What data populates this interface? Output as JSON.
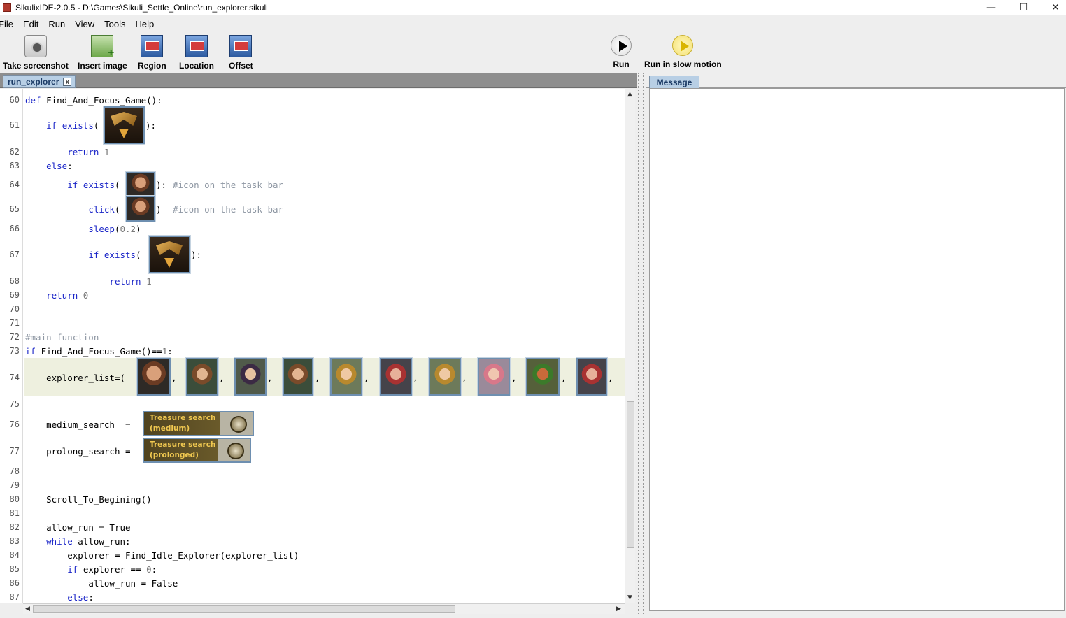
{
  "window": {
    "title": "SikulixIDE-2.0.5 - D:\\Games\\Sikuli_Settle_Online\\run_explorer.sikuli",
    "minimize": "—",
    "maximize": "☐",
    "close": "✕"
  },
  "menu": [
    "File",
    "Edit",
    "Run",
    "View",
    "Tools",
    "Help"
  ],
  "toolbar": {
    "take_screenshot": "Take screenshot",
    "insert_image": "Insert image",
    "region": "Region",
    "location": "Location",
    "offset": "Offset",
    "run": "Run",
    "run_slow": "Run in slow motion"
  },
  "tabs": {
    "editor_tab": "run_explorer",
    "close_symbol": "x",
    "message_tab": "Message"
  },
  "editor": {
    "lines": [
      {
        "n": "60",
        "text": "def Find_And_Focus_Game():"
      },
      {
        "n": "61",
        "text": "    if exists("
      },
      {
        "n": "62",
        "text": "        return 1"
      },
      {
        "n": "63",
        "text": "    else:"
      },
      {
        "n": "64",
        "text": "        if exists("
      },
      {
        "n": "65",
        "text": "            click("
      },
      {
        "n": "66",
        "text": "            sleep(0.2)"
      },
      {
        "n": "67",
        "text": "            if exists("
      },
      {
        "n": "68",
        "text": "                return 1"
      },
      {
        "n": "69",
        "text": "    return 0"
      },
      {
        "n": "70",
        "text": ""
      },
      {
        "n": "71",
        "text": ""
      },
      {
        "n": "72",
        "text": "#main function"
      },
      {
        "n": "73",
        "text": "if Find_And_Focus_Game()==1:"
      },
      {
        "n": "74",
        "text": "    explorer_list=("
      },
      {
        "n": "75",
        "text": ""
      },
      {
        "n": "76",
        "text": "    medium_search  ="
      },
      {
        "n": "77",
        "text": "    prolong_search ="
      },
      {
        "n": "78",
        "text": ""
      },
      {
        "n": "79",
        "text": ""
      },
      {
        "n": "80",
        "text": "    Scroll_To_Begining()"
      },
      {
        "n": "81",
        "text": ""
      },
      {
        "n": "82",
        "text": "    allow_run = True"
      },
      {
        "n": "83",
        "text": "    while allow_run:"
      },
      {
        "n": "84",
        "text": "        explorer = Find_Idle_Explorer(explorer_list)"
      },
      {
        "n": "85",
        "text": "        if explorer == 0:"
      },
      {
        "n": "86",
        "text": "            allow_run = False"
      },
      {
        "n": "87",
        "text": "        else:"
      }
    ],
    "suffix_61": "):",
    "suffix_64": "):",
    "comment_64": "#icon on the task bar",
    "suffix_65": ")",
    "comment_65": "#icon on the task bar",
    "suffix_67": "):",
    "comma": ",",
    "treasure_medium": [
      "Treasure search",
      "(medium)"
    ],
    "treasure_prolonged": [
      "Treasure search",
      "(prolonged)"
    ]
  }
}
